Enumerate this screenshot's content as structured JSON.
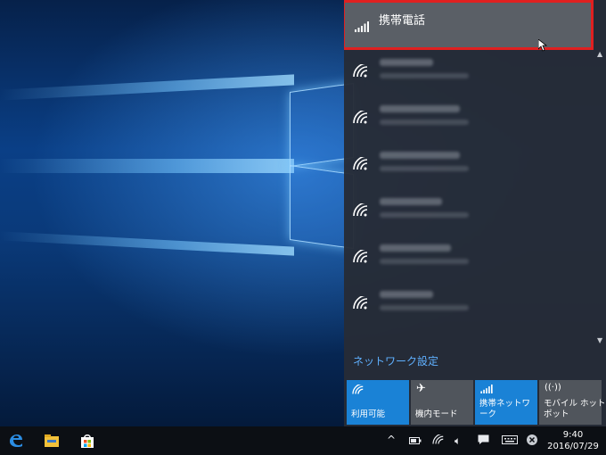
{
  "flyout": {
    "cellular": {
      "name": "携帯電話"
    },
    "network_settings_link": "ネットワーク設定",
    "quick_actions": [
      {
        "label": "利用可能",
        "state": "on",
        "icon": "wifi-icon"
      },
      {
        "label": "機内モード",
        "state": "off",
        "icon": "airplane-icon"
      },
      {
        "label": "携帯ネットワーク",
        "state": "on",
        "icon": "cellular-icon"
      },
      {
        "label": "モバイル ホットス\nポット",
        "state": "off",
        "icon": "hotspot-icon"
      }
    ]
  },
  "taskbar": {
    "pinned": [
      "edge-icon",
      "file-explorer-icon",
      "store-icon"
    ],
    "tray": [
      "chevron-up-icon",
      "battery-icon",
      "wifi-icon",
      "volume-icon",
      "action-center-icon",
      "keyboard-icon",
      "close-circle-icon"
    ],
    "clock": {
      "time": "9:40",
      "date": "2016/07/29"
    }
  },
  "colors": {
    "accent": "#1a82d6",
    "highlight_border": "#e02020",
    "link": "#5fb0ff"
  }
}
